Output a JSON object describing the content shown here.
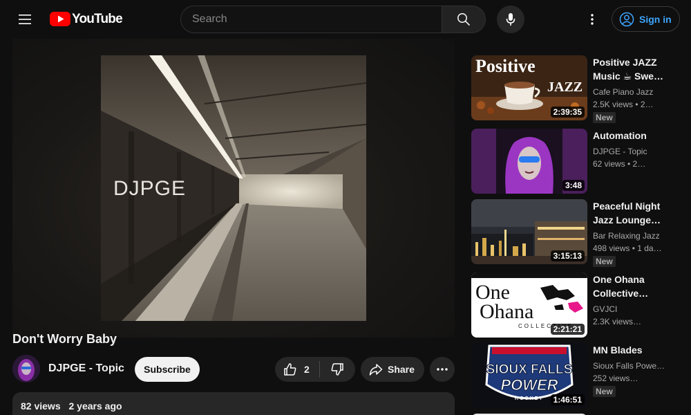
{
  "masthead": {
    "logo_text": "YouTube",
    "search_placeholder": "Search",
    "signin_label": "Sign in",
    "icons": [
      "menu-icon",
      "youtube-logo-icon",
      "search-icon",
      "mic-icon",
      "more-vert-icon",
      "account-icon"
    ]
  },
  "player": {
    "artwork_text": "DJPGE"
  },
  "video": {
    "title": "Don't Worry Baby",
    "channel": "DJPGE - Topic",
    "subscribe_label": "Subscribe",
    "like_count": "2",
    "share_label": "Share",
    "views": "82 views",
    "published": "2 years ago"
  },
  "recommendations": [
    {
      "title": "Positive JAZZ Music ☕ Swe…",
      "channel": "Cafe Piano Jazz",
      "meta": "2.5K views  • 2…",
      "badge": "New",
      "duration": "2:39:35",
      "thumb_text_1": "Positive",
      "thumb_text_2": "JAZZ"
    },
    {
      "title": "Automation",
      "channel": "DJPGE - Topic",
      "meta": "62 views  • 2…",
      "badge": "",
      "duration": "3:48"
    },
    {
      "title": "Peaceful Night Jazz Lounge…",
      "channel": "Bar Relaxing Jazz",
      "meta": "498 views  • 1 da…",
      "badge": "New",
      "duration": "3:15:13"
    },
    {
      "title": "One Ohana Collective…",
      "channel": "GVJCI",
      "meta": "2.3K views…",
      "badge": "",
      "duration": "2:21:21",
      "thumb_text_1": "One",
      "thumb_text_2": "Ohana",
      "thumb_text_3": "COLLECTIVE"
    },
    {
      "title": "MN Blades",
      "channel": "Sioux Falls Powe…",
      "meta": "252 views…",
      "badge": "New",
      "duration": "1:46:51",
      "thumb_text_1": "SIOUX FALLS",
      "thumb_text_2": "POWER",
      "thumb_text_3": "HOCKEY"
    }
  ],
  "colors": {
    "background": "#0f0f0f",
    "chip": "#272727",
    "brand_red": "#ff0000",
    "link_blue": "#3ea6ff",
    "secondary_text": "#aaaaaa"
  }
}
